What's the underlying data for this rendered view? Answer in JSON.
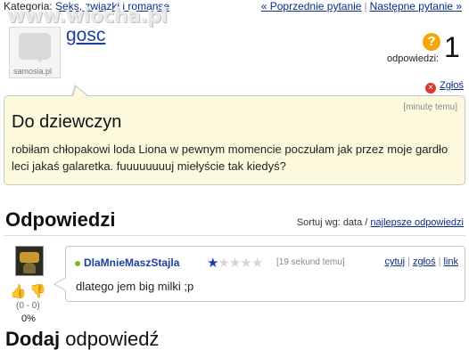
{
  "watermark": "www.wiocha.pl",
  "breadcrumb": {
    "label": "Kategoria:",
    "category": "Seks, związki i romanse"
  },
  "nav": {
    "prev": "« Poprzednie pytanie",
    "separator": "|",
    "next": "Następne pytanie »"
  },
  "question": {
    "author": "gosc",
    "avatar_logo": "samosia.pl",
    "answers_label": "odpowiedzi:",
    "answers_count": "1",
    "report": "Zgłoś",
    "time": "[minutę temu]",
    "title": "Do dziewczyn",
    "body": "robiłam chłopakowi loda Liona w pewnym momencie poczułam jak przez moje gardło leci jakaś galaretka. fuuuuuuuuj miełyście tak kiedyś?"
  },
  "answers_section": {
    "title": "Odpowiedzi",
    "sort_label": "Sortuj wg:",
    "sort_current": "data",
    "sort_separator": "/",
    "sort_other": "najlepsze odpowiedzi"
  },
  "answer": {
    "author": "DlaMnieMaszStajla",
    "rating": {
      "value": 1,
      "max": 5
    },
    "time": "[19 sekund temu]",
    "actions": {
      "quote": "cytuj",
      "report": "zgłoś",
      "link": "link",
      "separator": "|"
    },
    "text": "dlatego jem big milki ;p",
    "votes": "(0 - 0)",
    "percent": "0%"
  },
  "add_answer": {
    "bold": "Dodaj",
    "rest": " odpowiedź"
  },
  "colors": {
    "link": "#0b2c8c",
    "username": "#1a3fa6",
    "question_box": "#fdf9dd",
    "answers_icon": "#f5a60a",
    "report_icon": "#d93a2b",
    "online_dot": "#82b51a"
  },
  "icons": {
    "question": "question-mark-icon",
    "report": "close-circle-icon",
    "thumb_up": "thumb-up-icon",
    "thumb_down": "thumb-down-icon",
    "online": "online-dot-icon",
    "star": "star-icon"
  }
}
